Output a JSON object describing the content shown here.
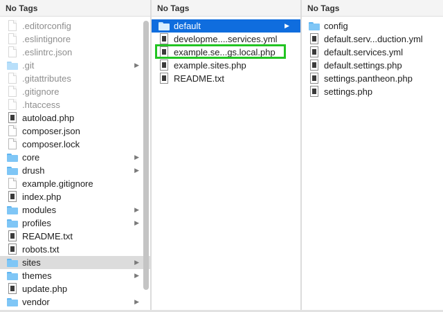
{
  "columns": [
    {
      "header": "No Tags",
      "items": [
        {
          "label": ".editorconfig",
          "kind": "doc",
          "hidden": true,
          "icon": "document-icon"
        },
        {
          "label": ".eslintignore",
          "kind": "doc",
          "hidden": true,
          "icon": "document-icon"
        },
        {
          "label": ".eslintrc.json",
          "kind": "doc",
          "hidden": true,
          "icon": "document-icon"
        },
        {
          "label": ".git",
          "kind": "folder",
          "hidden": true,
          "expandable": true,
          "icon": "folder-icon"
        },
        {
          "label": ".gitattributes",
          "kind": "doc",
          "hidden": true,
          "icon": "document-icon"
        },
        {
          "label": ".gitignore",
          "kind": "doc",
          "hidden": true,
          "icon": "document-icon"
        },
        {
          "label": ".htaccess",
          "kind": "doc",
          "hidden": true,
          "icon": "document-icon"
        },
        {
          "label": "autoload.php",
          "kind": "exec",
          "icon": "php-file-icon"
        },
        {
          "label": "composer.json",
          "kind": "doc",
          "icon": "document-icon"
        },
        {
          "label": "composer.lock",
          "kind": "doc",
          "icon": "document-icon"
        },
        {
          "label": "core",
          "kind": "folder",
          "expandable": true,
          "icon": "folder-icon"
        },
        {
          "label": "drush",
          "kind": "folder",
          "expandable": true,
          "icon": "folder-icon"
        },
        {
          "label": "example.gitignore",
          "kind": "doc",
          "icon": "document-icon"
        },
        {
          "label": "index.php",
          "kind": "exec",
          "icon": "php-file-icon"
        },
        {
          "label": "modules",
          "kind": "folder",
          "expandable": true,
          "icon": "folder-icon"
        },
        {
          "label": "profiles",
          "kind": "folder",
          "expandable": true,
          "icon": "folder-icon"
        },
        {
          "label": "README.txt",
          "kind": "exec",
          "icon": "text-file-icon"
        },
        {
          "label": "robots.txt",
          "kind": "exec",
          "icon": "text-file-icon"
        },
        {
          "label": "sites",
          "kind": "folder",
          "expandable": true,
          "selected": "gray",
          "icon": "folder-icon"
        },
        {
          "label": "themes",
          "kind": "folder",
          "expandable": true,
          "icon": "folder-icon"
        },
        {
          "label": "update.php",
          "kind": "exec",
          "icon": "php-file-icon"
        },
        {
          "label": "vendor",
          "kind": "folder",
          "expandable": true,
          "icon": "folder-icon"
        }
      ]
    },
    {
      "header": "No Tags",
      "items": [
        {
          "label": "default",
          "kind": "folder",
          "expandable": true,
          "selected": "blue",
          "icon": "folder-icon"
        },
        {
          "label": "developme....services.yml",
          "kind": "exec",
          "icon": "yml-file-icon"
        },
        {
          "label": "example.se...gs.local.php",
          "kind": "exec",
          "highlighted": true,
          "icon": "php-file-icon"
        },
        {
          "label": "example.sites.php",
          "kind": "exec",
          "icon": "php-file-icon"
        },
        {
          "label": "README.txt",
          "kind": "exec",
          "icon": "text-file-icon"
        }
      ]
    },
    {
      "header": "No Tags",
      "items": [
        {
          "label": "config",
          "kind": "folder",
          "icon": "folder-icon"
        },
        {
          "label": "default.serv...duction.yml",
          "kind": "exec",
          "icon": "yml-file-icon"
        },
        {
          "label": "default.services.yml",
          "kind": "exec",
          "icon": "yml-file-icon"
        },
        {
          "label": "default.settings.php",
          "kind": "exec",
          "icon": "php-file-icon"
        },
        {
          "label": "settings.pantheon.php",
          "kind": "exec",
          "icon": "php-file-icon"
        },
        {
          "label": "settings.php",
          "kind": "exec",
          "icon": "php-file-icon"
        }
      ]
    }
  ],
  "colors": {
    "selection_blue": "#0f6dde",
    "selection_gray": "#dcdcdc",
    "highlight_green": "#22c422",
    "folder_blue": "#7fc6f6"
  },
  "expand_glyph": "▶"
}
